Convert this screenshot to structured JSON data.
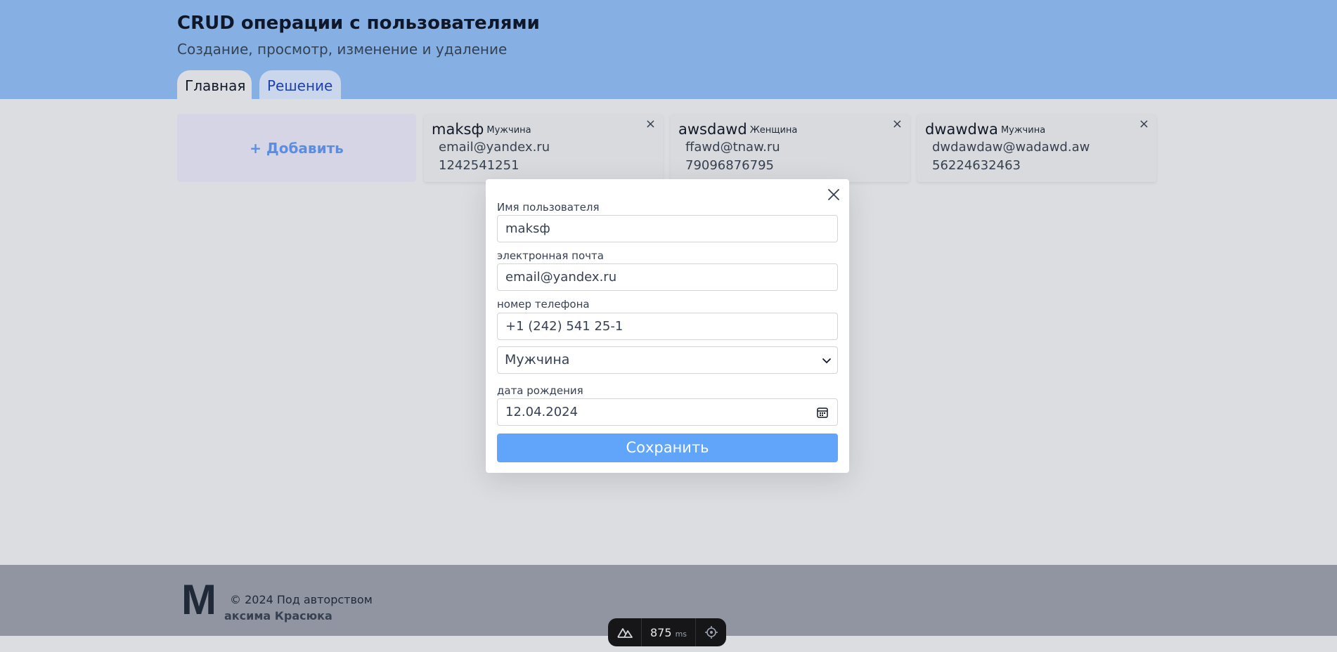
{
  "header": {
    "title": "CRUD операции с пользователями",
    "subtitle": "Создание, просмотр, изменение и удаление",
    "tabs": [
      {
        "label": "Главная"
      },
      {
        "label": "Решение"
      }
    ]
  },
  "add_button": {
    "label": "+ Добавить"
  },
  "users": [
    {
      "name": "maksф",
      "gender": "Мужчина",
      "email": "email@yandex.ru",
      "phone": "1242541251",
      "close": "×"
    },
    {
      "name": "awsdawd",
      "gender": "Женщина",
      "email": "ffawd@tnaw.ru",
      "phone": "79096876795",
      "close": "×"
    },
    {
      "name": "dwawdwa",
      "gender": "Мужчина",
      "email": "dwdawdaw@wadawd.aw",
      "phone": "56224632463",
      "close": "×"
    }
  ],
  "modal": {
    "username_label": "Имя пользователя",
    "username_value": "maksф",
    "email_label": "электронная почта",
    "email_value": "email@yandex.ru",
    "phone_label": "номер телефона",
    "phone_value": "+1 (242) 541 25-1",
    "gender_selected": "Мужчина",
    "birthdate_label": "дата рождения",
    "birthdate_value": "12.04.2024",
    "save_label": "Сохранить"
  },
  "footer": {
    "logo_letter": "M",
    "line1": "© 2024 Под авторством",
    "line2": "аксима Красюка"
  },
  "devbar": {
    "ms_value": "875",
    "ms_unit": "ms"
  },
  "colors": {
    "header_bg": "#86b0e3",
    "page_bg": "#dcdde1",
    "accent": "#60a5fa",
    "footer_bg": "#9195a1"
  }
}
